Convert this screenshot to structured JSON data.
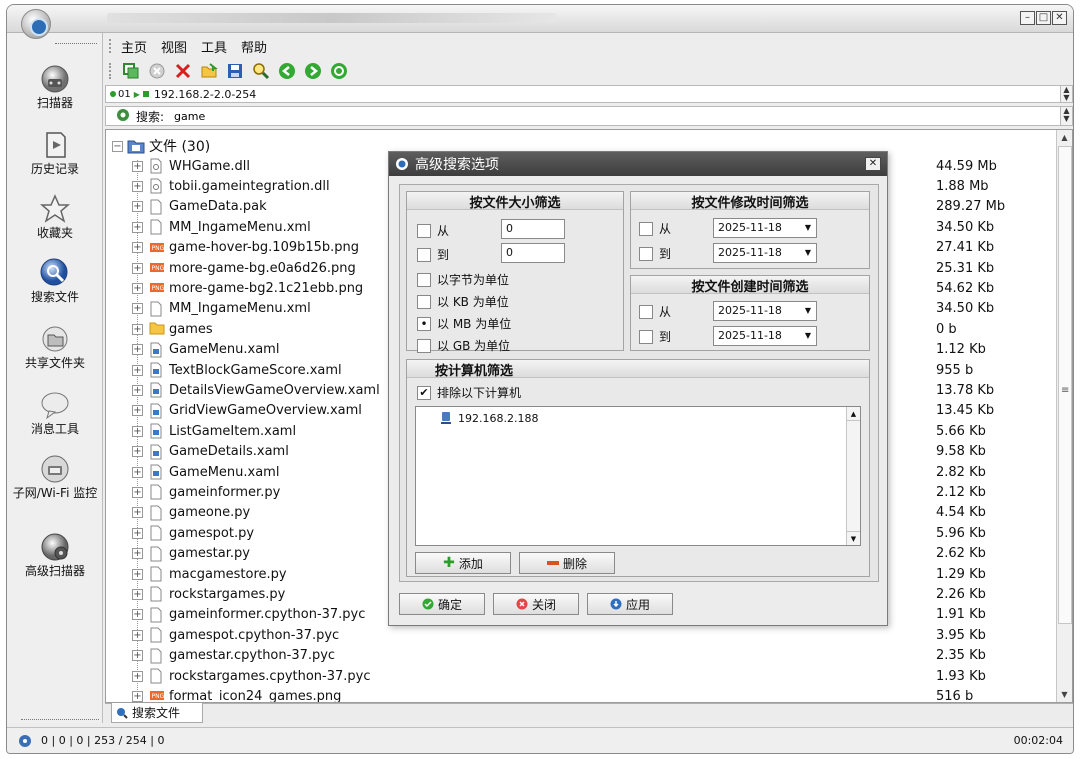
{
  "window": {
    "controls": [
      "minimize",
      "maximize",
      "close"
    ]
  },
  "menu": {
    "items": [
      "主页",
      "视图",
      "工具",
      "帮助"
    ]
  },
  "toolbar": {
    "icons": [
      "copy-green-icon",
      "cancel-icon",
      "delete-icon",
      "open-folder-icon",
      "save-icon",
      "search-icon",
      "back-icon",
      "forward-icon",
      "refresh-icon"
    ]
  },
  "sidebar": {
    "items": [
      {
        "label": "扫描器",
        "icon": "scanner-icon"
      },
      {
        "label": "历史记录",
        "icon": "history-icon"
      },
      {
        "label": "收藏夹",
        "icon": "star-icon"
      },
      {
        "label": "搜索文件",
        "icon": "search-files-icon"
      },
      {
        "label": "共享文件夹",
        "icon": "shared-folder-icon"
      },
      {
        "label": "消息工具",
        "icon": "message-icon"
      },
      {
        "label": "子网/Wi-Fi 监控",
        "icon": "wifi-monitor-icon"
      },
      {
        "label": "高级扫描器",
        "icon": "advanced-scanner-icon"
      }
    ]
  },
  "address": {
    "prefix": "01",
    "range": "192.168.2-2.0-254"
  },
  "search": {
    "label": "搜索:",
    "value": "game"
  },
  "tree": {
    "root_label": "文件 (30)",
    "files": [
      {
        "name": "WHGame.dll",
        "size": "44.59 Mb",
        "type": "dll"
      },
      {
        "name": "tobii.gameintegration.dll",
        "size": "1.88 Mb",
        "type": "dll"
      },
      {
        "name": "GameData.pak",
        "size": "289.27 Mb",
        "type": "file"
      },
      {
        "name": "MM_IngameMenu.xml",
        "size": "34.50 Kb",
        "type": "file"
      },
      {
        "name": "game-hover-bg.109b15b.png",
        "size": "27.41 Kb",
        "type": "png"
      },
      {
        "name": "more-game-bg.e0a6d26.png",
        "size": "25.31 Kb",
        "type": "png"
      },
      {
        "name": "more-game-bg2.1c21ebb.png",
        "size": "54.62 Kb",
        "type": "png"
      },
      {
        "name": "MM_IngameMenu.xml",
        "size": "34.50 Kb",
        "type": "file"
      },
      {
        "name": "games",
        "size": "0 b",
        "type": "folder"
      },
      {
        "name": "GameMenu.xaml",
        "size": "1.12 Kb",
        "type": "xaml"
      },
      {
        "name": "TextBlockGameScore.xaml",
        "size": "955 b",
        "type": "xaml"
      },
      {
        "name": "DetailsViewGameOverview.xaml",
        "size": "13.78 Kb",
        "type": "xaml"
      },
      {
        "name": "GridViewGameOverview.xaml",
        "size": "13.45 Kb",
        "type": "xaml"
      },
      {
        "name": "ListGameItem.xaml",
        "size": "5.66 Kb",
        "type": "xaml"
      },
      {
        "name": "GameDetails.xaml",
        "size": "9.58 Kb",
        "type": "xaml"
      },
      {
        "name": "GameMenu.xaml",
        "size": "2.82 Kb",
        "type": "xaml"
      },
      {
        "name": "gameinformer.py",
        "size": "2.12 Kb",
        "type": "file"
      },
      {
        "name": "gameone.py",
        "size": "4.54 Kb",
        "type": "file"
      },
      {
        "name": "gamespot.py",
        "size": "5.96 Kb",
        "type": "file"
      },
      {
        "name": "gamestar.py",
        "size": "2.62 Kb",
        "type": "file"
      },
      {
        "name": "macgamestore.py",
        "size": "1.29 Kb",
        "type": "file"
      },
      {
        "name": "rockstargames.py",
        "size": "2.26 Kb",
        "type": "file"
      },
      {
        "name": "gameinformer.cpython-37.pyc",
        "size": "1.91 Kb",
        "type": "file"
      },
      {
        "name": "gamespot.cpython-37.pyc",
        "size": "3.95 Kb",
        "type": "file"
      },
      {
        "name": "gamestar.cpython-37.pyc",
        "size": "2.35 Kb",
        "type": "file"
      },
      {
        "name": "rockstargames.cpython-37.pyc",
        "size": "1.93 Kb",
        "type": "file"
      },
      {
        "name": "format_icon24_games.png",
        "size": "516 b",
        "type": "png"
      }
    ]
  },
  "tabs": {
    "active": "搜索文件"
  },
  "status": {
    "counts": "0 | 0 | 0 | 253 / 254 | 0",
    "time": "00:02:04"
  },
  "dialog": {
    "title": "高级搜索选项",
    "size_group": {
      "title": "按文件大小筛选",
      "from_label": "从",
      "from_value": "0",
      "to_label": "到",
      "to_value": "0",
      "units": [
        {
          "label": "以字节为单位",
          "selected": false
        },
        {
          "label": "以 KB 为单位",
          "selected": false
        },
        {
          "label": "以 MB 为单位",
          "selected": true
        },
        {
          "label": "以 GB 为单位",
          "selected": false
        }
      ]
    },
    "modified_group": {
      "title": "按文件修改时间筛选",
      "from_label": "从",
      "from_date": "2025-11-18",
      "to_label": "到",
      "to_date": "2025-11-18"
    },
    "created_group": {
      "title": "按文件创建时间筛选",
      "from_label": "从",
      "from_date": "2025-11-18",
      "to_label": "到",
      "to_date": "2025-11-18"
    },
    "computer_group": {
      "title": "按计算机筛选",
      "exclude_label": "排除以下计算机",
      "exclude_checked": true,
      "computers": [
        "192.168.2.188"
      ],
      "add_label": "添加",
      "delete_label": "删除"
    },
    "buttons": {
      "ok": "确定",
      "close": "关闭",
      "apply": "应用"
    }
  }
}
